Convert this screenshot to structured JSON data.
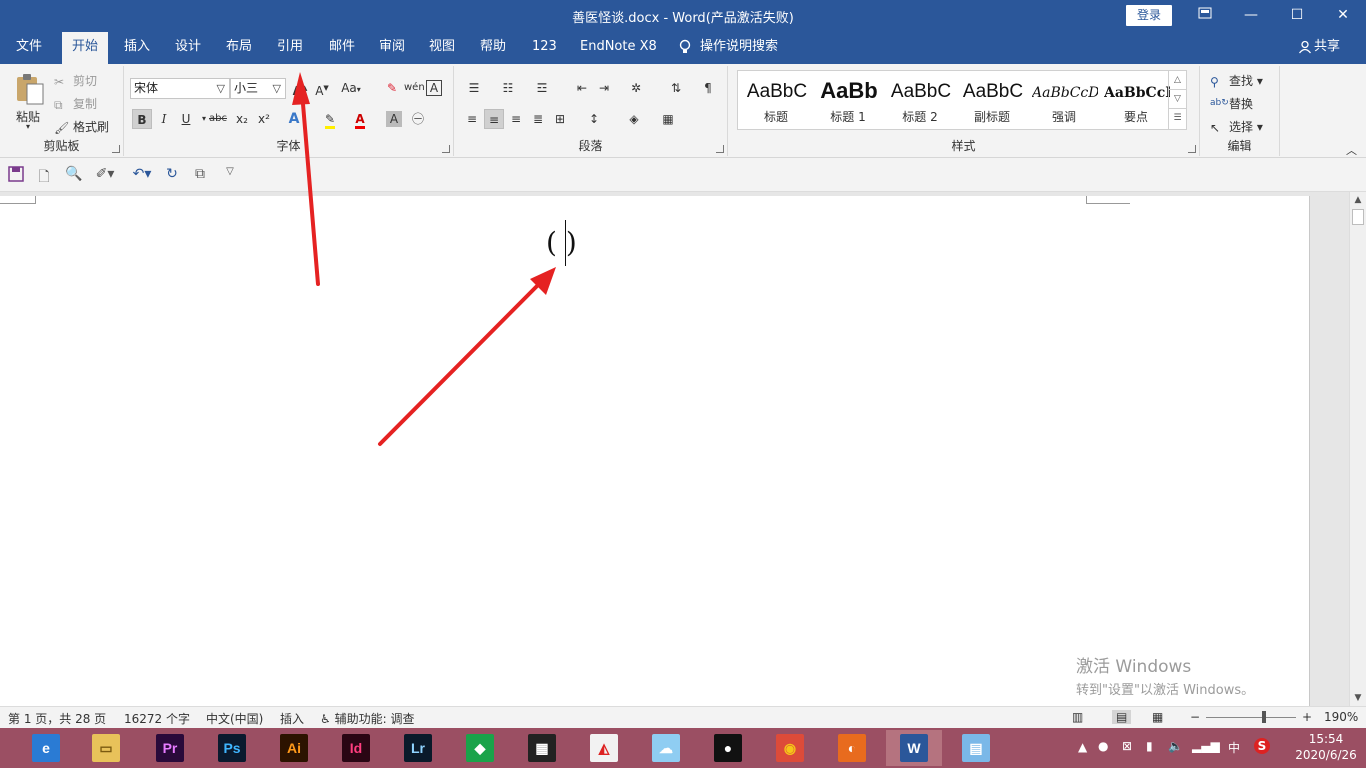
{
  "window": {
    "title": "善医怪谈.docx  -  Word(产品激活失败)",
    "login": "登录",
    "restore_ribbon_icon": "ribbon-display-icon",
    "minimize": "—",
    "maximize": "☐",
    "close": "✕"
  },
  "tabs": {
    "items": [
      "文件",
      "开始",
      "插入",
      "设计",
      "布局",
      "引用",
      "邮件",
      "审阅",
      "视图",
      "帮助",
      "123",
      "EndNote X8"
    ],
    "active": "开始",
    "search": "操作说明搜索",
    "share": "共享"
  },
  "ribbon": {
    "clipboard": {
      "paste": "粘贴",
      "cut": "剪切",
      "copy": "复制",
      "format_painter": "格式刷",
      "label": "剪贴板"
    },
    "font": {
      "font_name": "宋体",
      "font_size": "小三",
      "bold": "B",
      "italic": "I",
      "underline": "U",
      "strike": "abc",
      "subscript": "x₂",
      "superscript": "x²",
      "change_case": "Aa",
      "phonetic": "wén",
      "enclosed": "A",
      "label": "字体"
    },
    "paragraph": {
      "label": "段落"
    },
    "styles": {
      "label": "样式",
      "items": [
        {
          "preview": "AaBbC",
          "name": "标题"
        },
        {
          "preview": "AaBb",
          "name": "标题 1"
        },
        {
          "preview": "AaBbC",
          "name": "标题 2"
        },
        {
          "preview": "AaBbC",
          "name": "副标题"
        },
        {
          "preview": "AaBbCcD",
          "name": "强调"
        },
        {
          "preview": "AaBbCcD",
          "name": "要点"
        }
      ]
    },
    "editing": {
      "find": "查找",
      "replace": "替换",
      "select": "选择",
      "label": "编辑"
    }
  },
  "document": {
    "content": "( )",
    "watermark_line1": "激活 Windows",
    "watermark_line2": "转到\"设置\"以激活 Windows。"
  },
  "status": {
    "page": "第 1 页，共 28 页",
    "words": "16272 个字",
    "language": "中文(中国)",
    "mode": "插入",
    "accessibility": "辅助功能: 调查",
    "zoom": "190%"
  },
  "taskbar": {
    "apps": [
      {
        "name": "browser-icon",
        "label": "e",
        "color": "#2a7bd4",
        "fg": "#fff"
      },
      {
        "name": "file-explorer-icon",
        "label": "▭",
        "color": "#e8c25a",
        "fg": "#7a5a10"
      },
      {
        "name": "premiere-icon",
        "label": "Pr",
        "color": "#2a0a3a",
        "fg": "#e77cff"
      },
      {
        "name": "photoshop-icon",
        "label": "Ps",
        "color": "#0a1a2e",
        "fg": "#3fb6ff"
      },
      {
        "name": "illustrator-icon",
        "label": "Ai",
        "color": "#2c1300",
        "fg": "#ff9a1a"
      },
      {
        "name": "indesign-icon",
        "label": "Id",
        "color": "#2a0614",
        "fg": "#ff3e7f"
      },
      {
        "name": "lightroom-icon",
        "label": "Lr",
        "color": "#0a1a2a",
        "fg": "#8fd3ff"
      },
      {
        "name": "green-app-icon",
        "label": "◆",
        "color": "#1aa34a",
        "fg": "#fff"
      },
      {
        "name": "video-editor-icon",
        "label": "▦",
        "color": "#222",
        "fg": "#fff"
      },
      {
        "name": "picture-app-icon",
        "label": "◭",
        "color": "#f2f2f2",
        "fg": "#d22"
      },
      {
        "name": "cloud-app-icon",
        "label": "☁",
        "color": "#8fcdf2",
        "fg": "#fff"
      },
      {
        "name": "qq-icon",
        "label": "●",
        "color": "#111",
        "fg": "#fff"
      },
      {
        "name": "chrome-icon",
        "label": "◉",
        "color": "#dd4b39",
        "fg": "#f5c518"
      },
      {
        "name": "foxmail-icon",
        "label": "◐",
        "color": "#e86b1e",
        "fg": "#fff"
      },
      {
        "name": "word-icon",
        "label": "W",
        "color": "#2b579a",
        "fg": "#fff"
      },
      {
        "name": "notepad-icon",
        "label": "▤",
        "color": "#7ab8e8",
        "fg": "#fff"
      }
    ],
    "ime": "中",
    "time": "15:54",
    "date": "2020/6/26"
  },
  "colors": {
    "accent": "#2b579a",
    "annotation": "#e52222",
    "taskbar": "#9b4f63"
  }
}
